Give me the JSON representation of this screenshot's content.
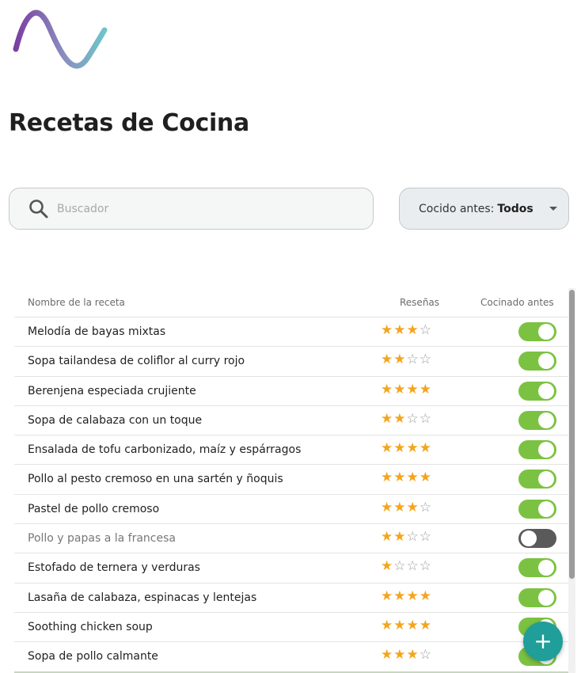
{
  "page": {
    "title": "Recetas de Cocina"
  },
  "search": {
    "placeholder": "Buscador",
    "value": "",
    "icon": "search-icon"
  },
  "filter": {
    "label": "Cocido antes:",
    "value": "Todos",
    "icon": "caret-down-icon"
  },
  "table": {
    "headers": {
      "name": "Nombre de la receta",
      "reviews": "Reseñas",
      "cooked": "Cocinado antes"
    },
    "rows": [
      {
        "name": "Melodía de bayas mixtas",
        "stars": 3,
        "cooked": true
      },
      {
        "name": "Sopa tailandesa de coliflor al curry rojo",
        "stars": 2,
        "cooked": true
      },
      {
        "name": "Berenjena especiada crujiente",
        "stars": 4,
        "cooked": true
      },
      {
        "name": "Sopa de calabaza con un toque",
        "stars": 2,
        "cooked": true
      },
      {
        "name": "Ensalada de tofu carbonizado, maíz y espárragos",
        "stars": 4,
        "cooked": true
      },
      {
        "name": "Pollo al pesto cremoso en una sartén y ñoquis",
        "stars": 4,
        "cooked": true
      },
      {
        "name": "Pastel de pollo cremoso",
        "stars": 3,
        "cooked": true
      },
      {
        "name": "Pollo y papas a la francesa",
        "stars": 2,
        "cooked": false
      },
      {
        "name": "Estofado de ternera y verduras",
        "stars": 1,
        "cooked": true
      },
      {
        "name": "Lasaña de calabaza, espinacas y lentejas",
        "stars": 4,
        "cooked": true
      },
      {
        "name": "Soothing chicken soup",
        "stars": 4,
        "cooked": true
      },
      {
        "name": "Sopa de pollo calmante",
        "stars": 3,
        "cooked": true
      }
    ],
    "max_stars": 4
  },
  "fab": {
    "label": "+",
    "icon": "plus-icon"
  },
  "colors": {
    "accent": "#1f9e9a",
    "toggle_on": "#7cc242",
    "toggle_off": "#5a5a5a",
    "star": "#f4a51c",
    "logo_start": "#7b3fa0",
    "logo_end": "#6fc5c9"
  }
}
